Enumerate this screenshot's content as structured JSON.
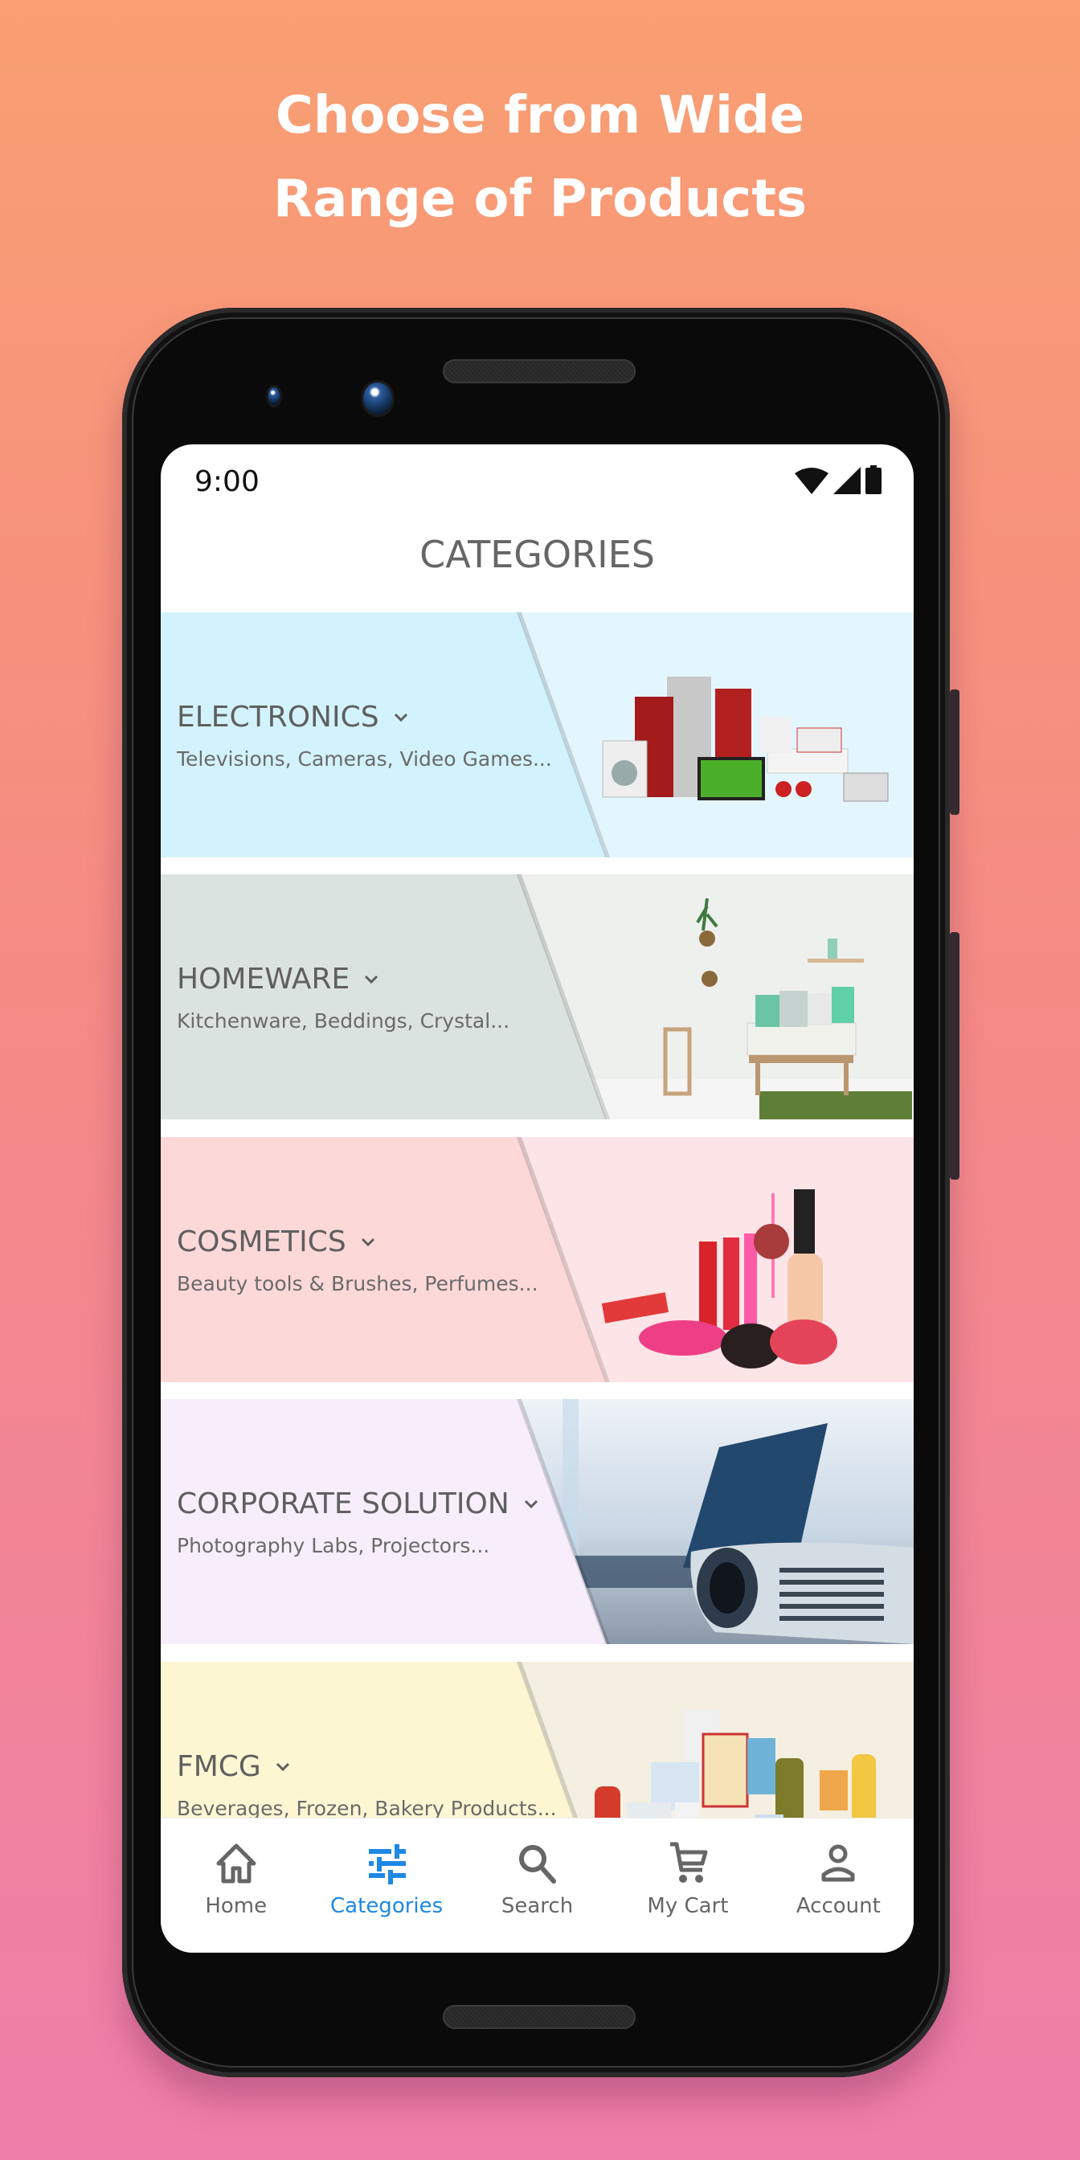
{
  "promo": {
    "headline_line1": "Choose from Wide",
    "headline_line2": "Range of Products"
  },
  "status_bar": {
    "time": "9:00",
    "icons": [
      "wifi-icon",
      "cellular-signal-icon",
      "battery-icon"
    ]
  },
  "header": {
    "title": "CATEGORIES"
  },
  "categories": [
    {
      "title": "ELECTRONICS",
      "subtitle": "Televisions, Cameras, Video Games...",
      "left_color": "#d2f3fd",
      "right_color": "#e4f6fd",
      "image": "home-appliances-image"
    },
    {
      "title": "HOMEWARE",
      "subtitle": "Kitchenware, Beddings, Crystal...",
      "left_color": "#dbe3e0",
      "right_color": "#eef0ee",
      "image": "living-room-image"
    },
    {
      "title": "COSMETICS",
      "subtitle": "Beauty tools & Brushes, Perfumes...",
      "left_color": "#fdd8d8",
      "right_color": "#fde4e6",
      "image": "makeup-products-image"
    },
    {
      "title": "CORPORATE SOLUTION",
      "subtitle": "Photography Labs, Projectors...",
      "left_color": "#f8eefb",
      "right_color": "#dfe7ef",
      "image": "projector-laptop-image"
    },
    {
      "title": "FMCG",
      "subtitle": "Beverages, Frozen, Bakery Products...",
      "left_color": "#fdf6d3",
      "right_color": "#f4efe0",
      "image": "grocery-products-image"
    }
  ],
  "bottom_nav": {
    "active_color": "#1e88e5",
    "inactive_color": "#666666",
    "items": [
      {
        "label": "Home",
        "icon": "home-icon",
        "active": false
      },
      {
        "label": "Categories",
        "icon": "tune-sliders-icon",
        "active": true
      },
      {
        "label": "Search",
        "icon": "search-icon",
        "active": false
      },
      {
        "label": "My Cart",
        "icon": "cart-icon",
        "active": false
      },
      {
        "label": "Account",
        "icon": "account-icon",
        "active": false
      }
    ]
  }
}
